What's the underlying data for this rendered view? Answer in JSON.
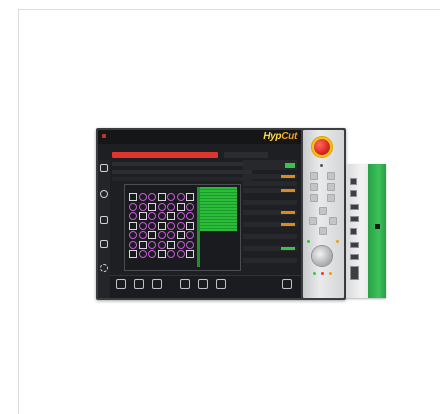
{
  "brand": {
    "logo_text": "HypCut",
    "logo_prefix": "Hyp",
    "logo_suffix": "Cut"
  },
  "screen": {
    "topbar_text": "",
    "alarm_text": "",
    "sidebar_items": [
      {
        "icon": "camera-icon",
        "label": ""
      },
      {
        "icon": "gauge-icon",
        "label": ""
      },
      {
        "icon": "image-icon",
        "label": ""
      },
      {
        "icon": "plugin-icon",
        "label": ""
      },
      {
        "icon": "gear-icon",
        "label": ""
      }
    ],
    "bottom_buttons": [
      {
        "icon": "grid-icon",
        "label": ""
      },
      {
        "icon": "grid-icon",
        "label": ""
      },
      {
        "icon": "layers-icon",
        "label": ""
      },
      {
        "icon": "grid-icon",
        "label": ""
      },
      {
        "icon": "grid-icon",
        "label": ""
      },
      {
        "icon": "grid-icon",
        "label": ""
      },
      {
        "icon": "return-icon",
        "label": ""
      }
    ]
  },
  "colors": {
    "accent_orange": "#f0a31b",
    "alarm_red": "#e0342e",
    "grid_green": "#2bbd3a",
    "part_magenta": "#c85bd8",
    "module_green": "#3cc15b",
    "estop_red": "#d8271d",
    "estop_yellow": "#f2c21c"
  }
}
